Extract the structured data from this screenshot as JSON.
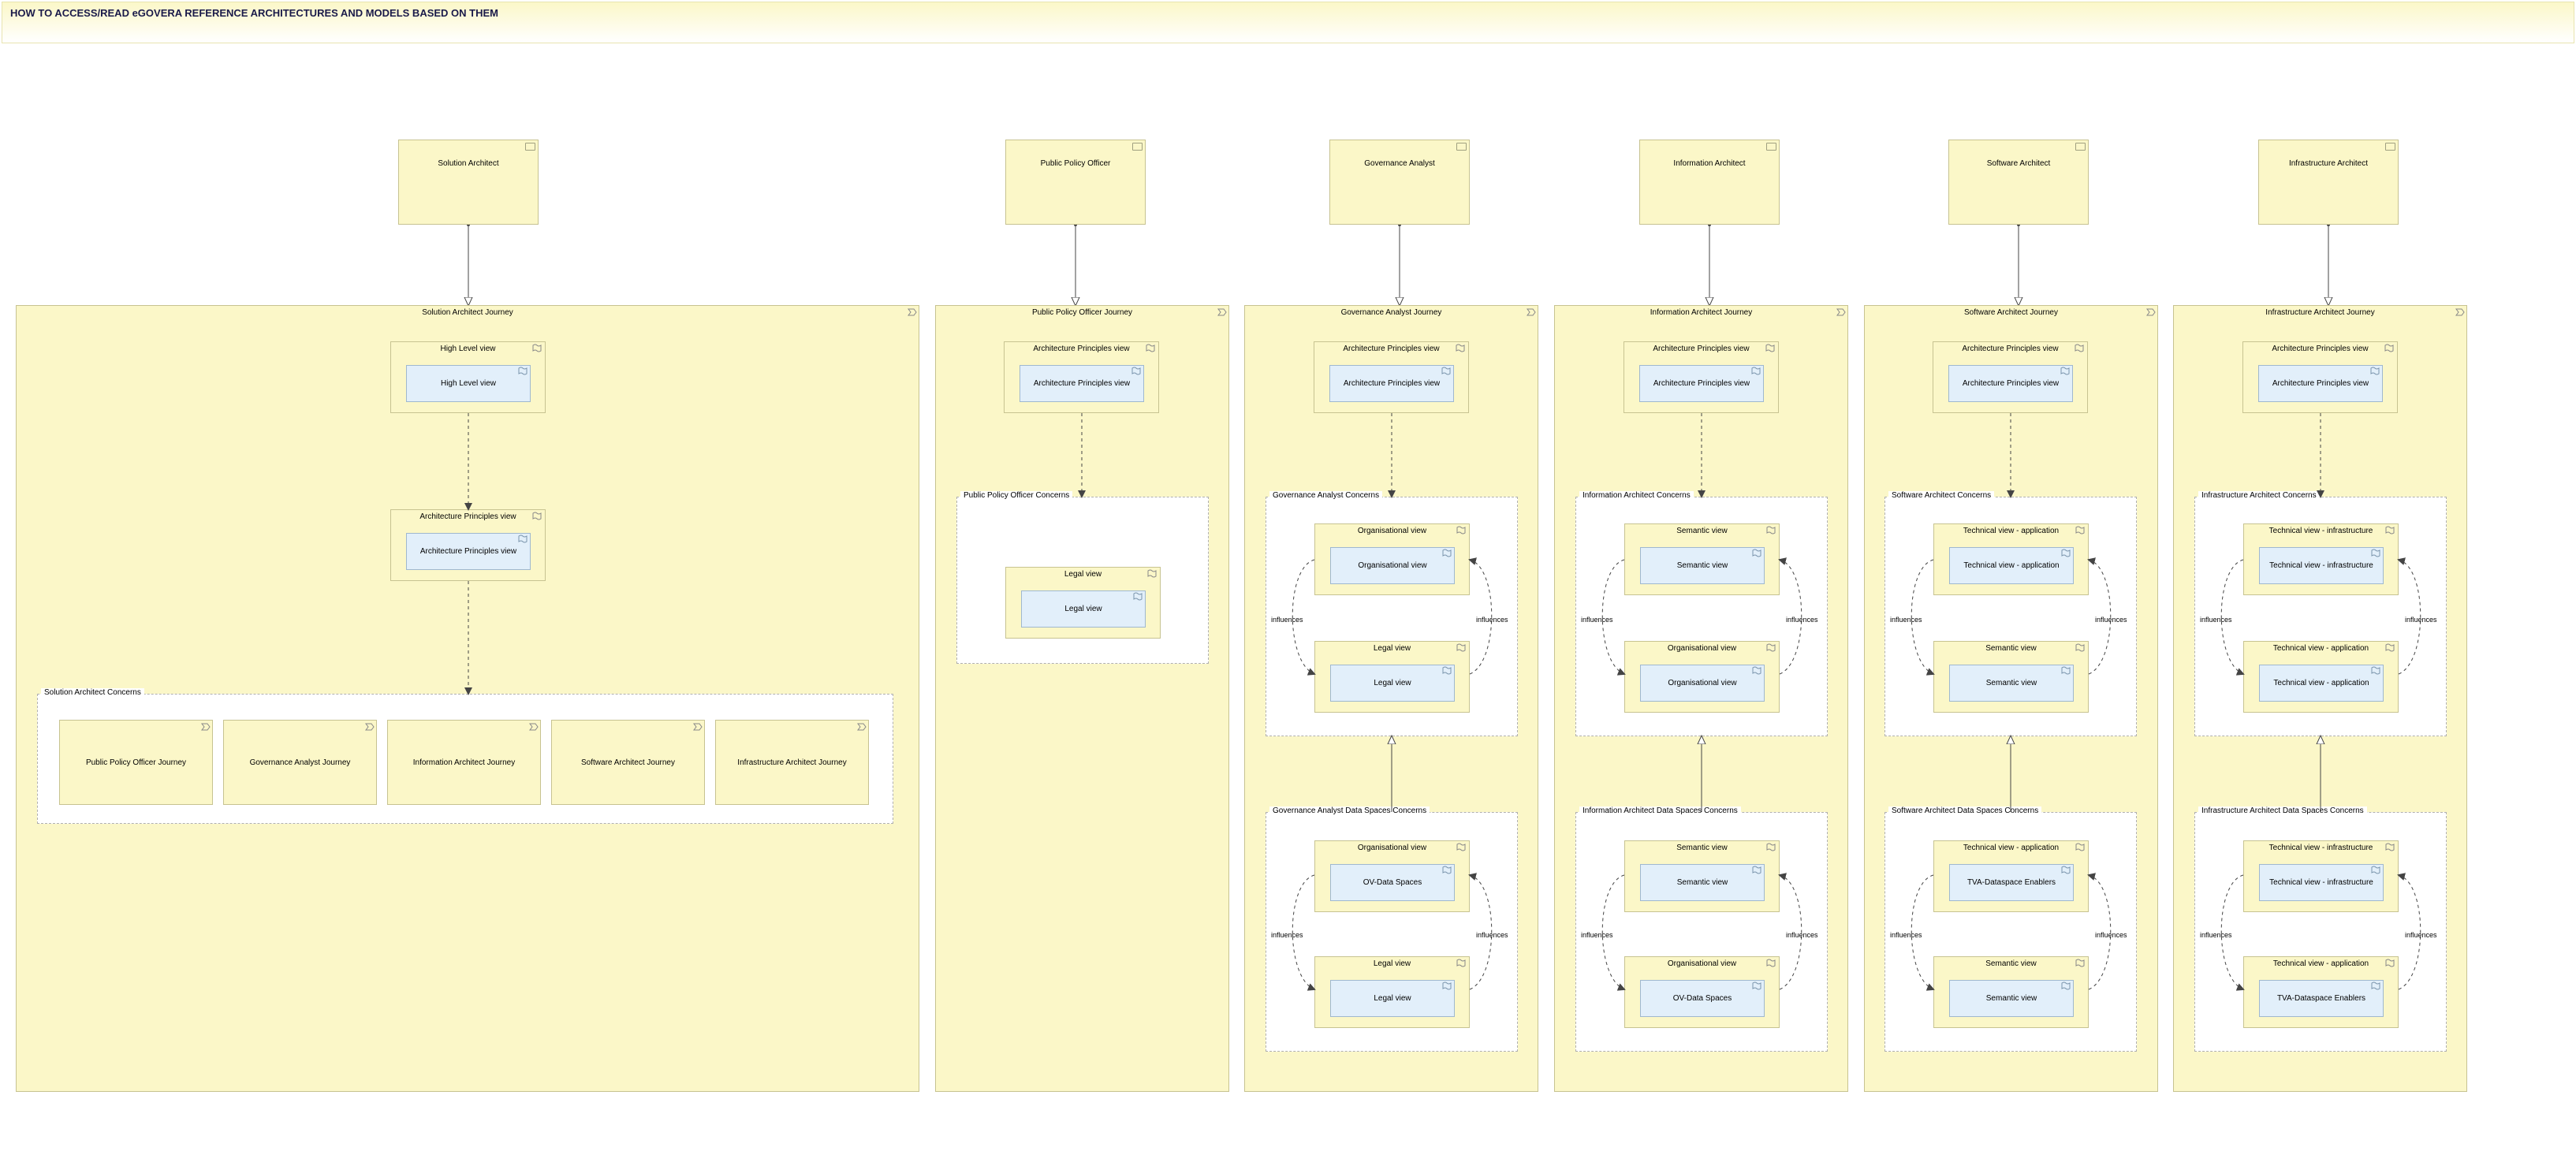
{
  "title": "HOW TO ACCESS/READ eGOVERA REFERENCE ARCHITECTURES AND MODELS BASED ON THEM",
  "influences_label": "influences",
  "roles": {
    "sa": "Solution Architect",
    "ppo": "Public Policy Officer",
    "ga": "Governance Analyst",
    "ia": "Information Architect",
    "swa": "Software Architect",
    "ira": "Infrastructure Architect"
  },
  "journeys": {
    "sa": "Solution Architect Journey",
    "ppo": "Public Policy Officer Journey",
    "ga": "Governance Analyst Journey",
    "ia": "Information Architect Journey",
    "swa": "Software Architect Journey",
    "ira": "Infrastructure Architect Journey"
  },
  "views": {
    "high_level": "High Level view",
    "arch_principles": "Architecture Principles view",
    "legal": "Legal view",
    "organisational": "Organisational view",
    "semantic": "Semantic view",
    "tech_app": "Technical view - application",
    "tech_infra": "Technical view - infrastructure",
    "ov_dataspaces": "OV-Data Spaces",
    "tva_dataspace": "TVA-Dataspace Enablers"
  },
  "groups": {
    "sa_concerns": "Solution Architect Concerns",
    "ppo_concerns": "Public Policy Officer Concerns",
    "ga_concerns": "Governance Analyst Concerns",
    "ga_ds_concerns": "Governance Analyst Data Spaces Concerns",
    "ia_concerns": "Information Architect Concerns",
    "ia_ds_concerns": "Information Architect Data Spaces Concerns",
    "swa_concerns": "Software Architect Concerns",
    "swa_ds_concerns": "Software Architect Data Spaces Concerns",
    "ira_concerns": "Infrastructure Architect Concerns",
    "ira_ds_concerns": "Infrastructure Architect Data Spaces Concerns"
  },
  "concern_cards": {
    "ppo": "Public Policy Officer Journey",
    "ga": "Governance Analyst Journey",
    "ia": "Information Architect Journey",
    "swa": "Software Architect Journey",
    "ira": "Infrastructure Architect Journey"
  }
}
